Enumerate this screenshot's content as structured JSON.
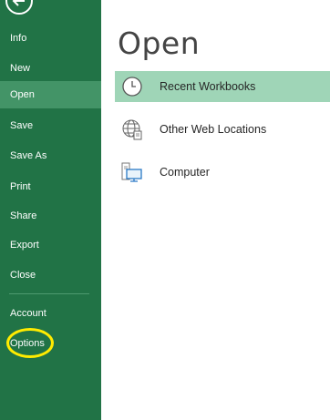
{
  "sidebar": {
    "items": [
      {
        "label": "Info"
      },
      {
        "label": "New"
      },
      {
        "label": "Open"
      },
      {
        "label": "Save"
      },
      {
        "label": "Save As"
      },
      {
        "label": "Print"
      },
      {
        "label": "Share"
      },
      {
        "label": "Export"
      },
      {
        "label": "Close"
      },
      {
        "label": "Account"
      },
      {
        "label": "Options"
      }
    ],
    "active_item": "Open"
  },
  "main": {
    "title": "Open",
    "locations": [
      {
        "label": "Recent Workbooks",
        "icon": "clock-icon"
      },
      {
        "label": "Other Web Locations",
        "icon": "globe-icon"
      },
      {
        "label": "Computer",
        "icon": "computer-icon"
      }
    ]
  },
  "colors": {
    "sidebar_bg": "#217346",
    "sidebar_active": "#439467",
    "location_active": "#9fd5b7",
    "annotation_ring": "#ffeb00"
  }
}
